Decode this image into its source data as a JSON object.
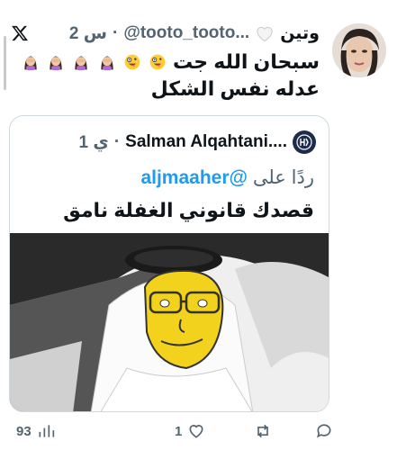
{
  "app": {
    "logo_icon": "x-logo-icon"
  },
  "header": {
    "time": "2 س",
    "separator": "·",
    "handle": "@tooto_tooto...",
    "name": "وتين",
    "heart_icon": "white-heart-icon"
  },
  "tweet": {
    "line1_prefix": "سبحان الله جت",
    "line2": "عدله نفس الشكل",
    "emojis": [
      "zany-face",
      "zany-face",
      "woman-facepalming",
      "woman-facepalming",
      "woman-facepalming",
      "woman-facepalming"
    ]
  },
  "quote": {
    "time": "1 ي",
    "separator": "·",
    "name": "Salman Alqahtani....",
    "reply_prefix": "ردًا على",
    "reply_mention": "@aljmaaher",
    "text": "قصدك قانوني الغفلة نامق"
  },
  "actions": {
    "views": "93",
    "likes": "1",
    "retweets": "",
    "replies": ""
  },
  "colors": {
    "accent": "#1d9bf0",
    "muted": "#536471",
    "text": "#0f1419",
    "border": "#cfd9de"
  }
}
